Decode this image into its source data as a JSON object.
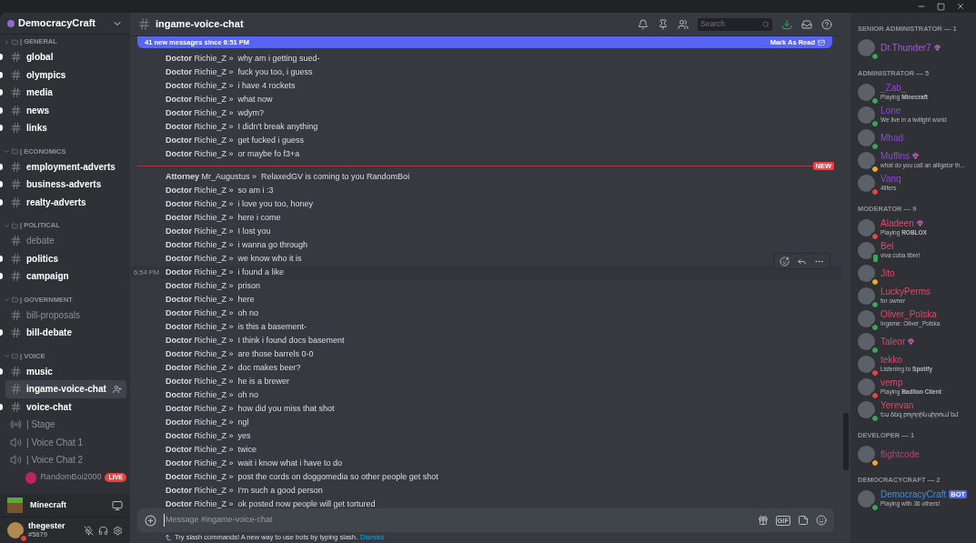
{
  "server": {
    "name": "DemocracyCraft"
  },
  "categories": [
    {
      "name": "| GENERAL",
      "expanded": false,
      "channels": [
        {
          "name": "global",
          "kind": "text",
          "unread": true,
          "selected": false
        },
        {
          "name": "olympics",
          "kind": "text",
          "unread": true,
          "selected": false
        },
        {
          "name": "media",
          "kind": "text",
          "unread": true,
          "selected": false
        },
        {
          "name": "news",
          "kind": "text",
          "unread": true,
          "selected": false
        },
        {
          "name": "links",
          "kind": "text",
          "unread": true,
          "selected": false
        }
      ]
    },
    {
      "name": "| ECONOMICS",
      "expanded": true,
      "channels": [
        {
          "name": "employment-adverts",
          "kind": "text",
          "unread": true,
          "selected": false
        },
        {
          "name": "business-adverts",
          "kind": "text",
          "unread": true,
          "selected": false
        },
        {
          "name": "realty-adverts",
          "kind": "text",
          "unread": true,
          "selected": false
        }
      ]
    },
    {
      "name": "| POLITICAL",
      "expanded": true,
      "channels": [
        {
          "name": "debate",
          "kind": "text",
          "unread": false,
          "selected": false
        },
        {
          "name": "politics",
          "kind": "text",
          "unread": true,
          "selected": false
        },
        {
          "name": "campaign",
          "kind": "text",
          "unread": true,
          "selected": false
        }
      ]
    },
    {
      "name": "| GOVERNMENT",
      "expanded": true,
      "channels": [
        {
          "name": "bill-proposals",
          "kind": "text",
          "unread": false,
          "selected": false
        },
        {
          "name": "bill-debate",
          "kind": "text",
          "unread": true,
          "selected": false
        }
      ]
    },
    {
      "name": "| VOICE",
      "expanded": true,
      "channels": [
        {
          "name": "music",
          "kind": "text",
          "unread": true,
          "selected": false
        },
        {
          "name": "ingame-voice-chat",
          "kind": "text",
          "unread": false,
          "selected": true
        },
        {
          "name": "voice-chat",
          "kind": "text",
          "unread": true,
          "selected": false
        },
        {
          "name": "| Stage",
          "kind": "stage",
          "unread": false,
          "selected": false
        },
        {
          "name": "| Voice Chat 1",
          "kind": "voice",
          "unread": false,
          "selected": false
        },
        {
          "name": "| Voice Chat 2",
          "kind": "voice",
          "unread": false,
          "selected": false,
          "users": [
            {
              "name": "RandomBoi2000",
              "badge": "LIVE"
            }
          ]
        }
      ]
    }
  ],
  "activity": {
    "name": "Minecraft"
  },
  "user": {
    "name": "thegester",
    "tag": "#5879",
    "color": "#ed4245"
  },
  "channel": {
    "name": "ingame-voice-chat",
    "search_placeholder": "Search"
  },
  "banner": {
    "text": "41 new messages since 6:51 PM",
    "action": "Mark As Read"
  },
  "messages": [
    {
      "kind": "message",
      "line": "**Doctor** Richie_Z »  why am i getting sued-",
      "hovered": false
    },
    {
      "kind": "message",
      "line": "**Doctor** Richie_Z »  fuck you too, i guess",
      "hovered": false
    },
    {
      "kind": "message",
      "line": "**Doctor** Richie_Z »  i have 4 rockets",
      "hovered": false
    },
    {
      "kind": "message",
      "line": "**Doctor** Richie_Z »  what now",
      "hovered": false
    },
    {
      "kind": "message",
      "line": "**Doctor** Richie_Z »  wdym?",
      "hovered": false
    },
    {
      "kind": "message",
      "line": "**Doctor** Richie_Z »  I didn't break anything",
      "hovered": false
    },
    {
      "kind": "message",
      "line": "**Doctor** Richie_Z »  get fucked i guess",
      "hovered": false
    },
    {
      "kind": "message",
      "line": "**Doctor** Richie_Z »  or maybe fo f3+a",
      "hovered": false
    },
    {
      "kind": "divider",
      "label": "NEW"
    },
    {
      "kind": "message",
      "line": "**Attorney** Mr_Augustus »  RelaxedGV is coming to you RandomBoi",
      "hovered": false
    },
    {
      "kind": "message",
      "line": "**Doctor** Richie_Z »  so am i :3",
      "hovered": false
    },
    {
      "kind": "message",
      "line": "**Doctor** Richie_Z »  i love you too, honey",
      "hovered": false
    },
    {
      "kind": "message",
      "line": "**Doctor** Richie_Z »  here i come",
      "hovered": false
    },
    {
      "kind": "message",
      "line": "**Doctor** Richie_Z »  I lost you",
      "hovered": false
    },
    {
      "kind": "message",
      "line": "**Doctor** Richie_Z »  i wanna go through",
      "hovered": false
    },
    {
      "kind": "message",
      "line": "**Doctor** Richie_Z »  we know who it is",
      "hovered": false
    },
    {
      "kind": "message",
      "line": "**Doctor** Richie_Z »  i found a like",
      "hovered": true,
      "time": "6:54 PM"
    },
    {
      "kind": "message",
      "line": "**Doctor** Richie_Z »  prison",
      "hovered": false
    },
    {
      "kind": "message",
      "line": "**Doctor** Richie_Z »  here",
      "hovered": false
    },
    {
      "kind": "message",
      "line": "**Doctor** Richie_Z »  oh no",
      "hovered": false
    },
    {
      "kind": "message",
      "line": "**Doctor** Richie_Z »  is this a basement-",
      "hovered": false
    },
    {
      "kind": "message",
      "line": "**Doctor** Richie_Z »  I think i found docs basement",
      "hovered": false
    },
    {
      "kind": "message",
      "line": "**Doctor** Richie_Z »  are those barrels 0-0",
      "hovered": false
    },
    {
      "kind": "message",
      "line": "**Doctor** Richie_Z »  doc makes beer?",
      "hovered": false
    },
    {
      "kind": "message",
      "line": "**Doctor** Richie_Z »  he is a brewer",
      "hovered": false
    },
    {
      "kind": "message",
      "line": "**Doctor** Richie_Z »  oh no",
      "hovered": false
    },
    {
      "kind": "message",
      "line": "**Doctor** Richie_Z »  how did you miss that shot",
      "hovered": false
    },
    {
      "kind": "message",
      "line": "**Doctor** Richie_Z »  ngl",
      "hovered": false
    },
    {
      "kind": "message",
      "line": "**Doctor** Richie_Z »  yes",
      "hovered": false
    },
    {
      "kind": "message",
      "line": "**Doctor** Richie_Z »  twice",
      "hovered": false
    },
    {
      "kind": "message",
      "line": "**Doctor** Richie_Z »  wait i know what i have to do",
      "hovered": false
    },
    {
      "kind": "message",
      "line": "**Doctor** Richie_Z »  post the cords on doggomedia so other people get shot",
      "hovered": false
    },
    {
      "kind": "message",
      "line": "**Doctor** Richie_Z »  I'm such a good person",
      "hovered": false
    },
    {
      "kind": "message",
      "line": "**Doctor** Richie_Z »  ok posted now people will get tortured",
      "hovered": false
    }
  ],
  "composer": {
    "placeholder": "Message #ingame-voice-chat",
    "gif_label": "GIF"
  },
  "hint": {
    "text": "Try slash commands! A new way to use bots by typing slash.",
    "link": "Dismiss"
  },
  "member_groups": [
    {
      "title": "SENIOR ADMINISTRATOR — 1",
      "color": "#a35bd6",
      "members": [
        {
          "name": "Dr.Thunder7",
          "color": "#3ba55d",
          "mobile": false,
          "boosting": true
        }
      ]
    },
    {
      "title": "ADMINISTRATOR — 5",
      "color": "#9146d8",
      "members": [
        {
          "name": "_Zab_",
          "activity": "Playing **Minecraft**",
          "color": "#3ba55d",
          "mobile": false,
          "boosting": false
        },
        {
          "name": "Lone",
          "activity": "We live in a twilight world",
          "color": "#3ba55d",
          "mobile": false,
          "boosting": false
        },
        {
          "name": "Mhad",
          "color": "#3ba55d",
          "mobile": false,
          "boosting": false
        },
        {
          "name": "Muffins",
          "activity": "what do you call an alligator th...",
          "color": "#faa81a",
          "mobile": false,
          "boosting": true
        },
        {
          "name": "Vanq",
          "activity": "4lifers",
          "color": "#ed4245",
          "mobile": false,
          "boosting": false
        }
      ]
    },
    {
      "title": "MODERATOR — 9",
      "color": "#e5466a",
      "members": [
        {
          "name": "Aladeen",
          "activity": "Playing **ROBLOX**",
          "color": "#ed4245",
          "mobile": false,
          "boosting": true
        },
        {
          "name": "Bel",
          "activity": "viva cuba libre!",
          "color": "#3ba55d",
          "mobile": true,
          "boosting": false
        },
        {
          "name": "Jito",
          "color": "#faa81a",
          "mobile": false,
          "boosting": false
        },
        {
          "name": "LuckyPerms",
          "activity": "for owner",
          "color": "#3ba55d",
          "mobile": false,
          "boosting": false
        },
        {
          "name": "Oliver_Polska",
          "activity": "Ingame: Oliver_Polska",
          "color": "#3ba55d",
          "mobile": false,
          "boosting": false
        },
        {
          "name": "Taleor",
          "color": "#3ba55d",
          "mobile": false,
          "boosting": true
        },
        {
          "name": "tekko",
          "activity": "Listening to **Spotify**",
          "color": "#ed4245",
          "mobile": false,
          "boosting": false
        },
        {
          "name": "vemp",
          "activity": "Playing **Badlion Client**",
          "color": "#ed4245",
          "mobile": false,
          "boosting": false
        },
        {
          "name": "Yerevan",
          "activity": "Ես ձեզ բոլորին սիրում եմ",
          "color": "#3ba55d",
          "mobile": false,
          "boosting": false
        }
      ]
    },
    {
      "title": "DEVELOPER — 1",
      "color": "#b8427d",
      "members": [
        {
          "name": "flightcode",
          "color": "#faa81a",
          "mobile": false,
          "boosting": false
        }
      ]
    },
    {
      "title": "DEMOCRACYCRAFT — 2",
      "color": "#3b8fe5",
      "members": [
        {
          "name": "DemocracyCraft",
          "activity": "Playing with 36 others!",
          "color": "#3ba55d",
          "mobile": false,
          "boosting": false,
          "tag": "BOT"
        }
      ]
    }
  ]
}
